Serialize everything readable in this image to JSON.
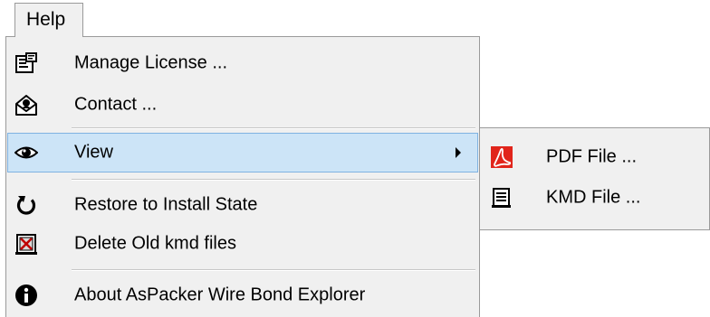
{
  "menubar": {
    "help_label": "Help"
  },
  "help_menu": {
    "items": [
      {
        "label": "Manage License ...",
        "icon": "license-certificate-icon"
      },
      {
        "label": "Contact ...",
        "icon": "envelope-contact-icon"
      },
      {
        "label": "View",
        "icon": "eye-icon",
        "has_submenu": true,
        "highlighted": true
      },
      {
        "label": "Restore to Install State",
        "icon": "restore-arrow-icon"
      },
      {
        "label": "Delete Old kmd files",
        "icon": "delete-files-icon"
      },
      {
        "label": "About AsPacker Wire Bond Explorer",
        "icon": "info-icon"
      }
    ]
  },
  "view_submenu": {
    "items": [
      {
        "label": "PDF File ...",
        "icon": "pdf-icon"
      },
      {
        "label": "KMD File ...",
        "icon": "document-icon"
      }
    ]
  },
  "colors": {
    "menu_background": "#f0f0f0",
    "highlight_background": "#cce4f7",
    "highlight_border": "#7fb2e1",
    "pdf_red": "#e1251b"
  }
}
